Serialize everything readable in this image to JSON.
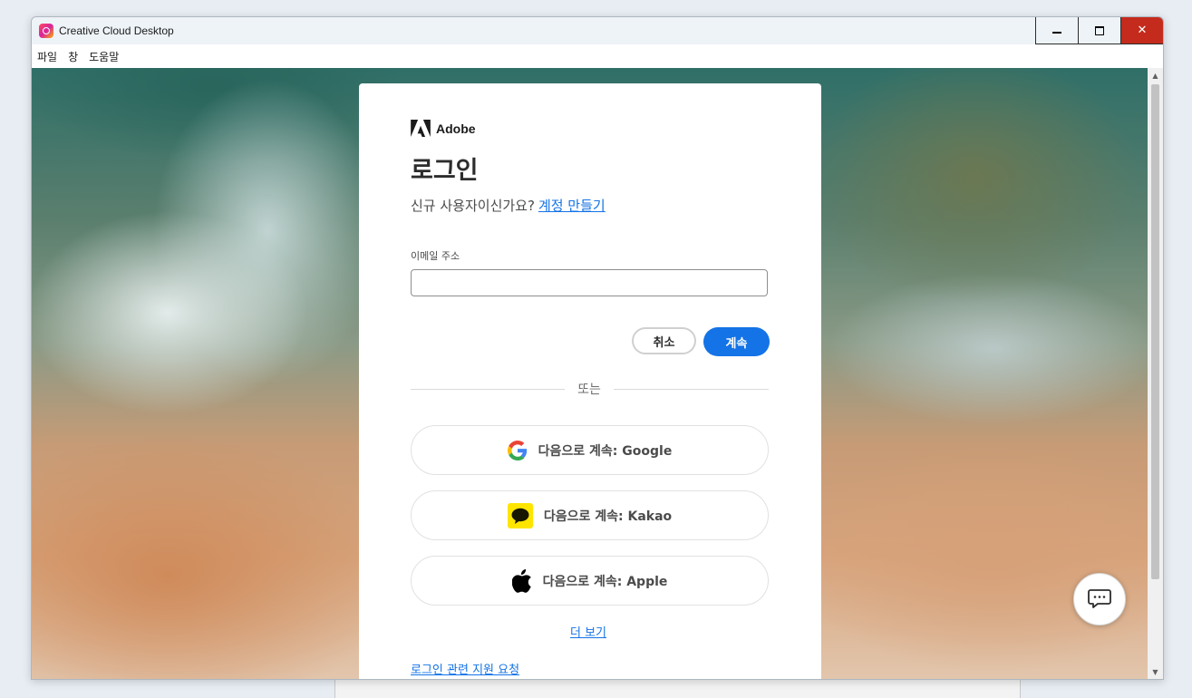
{
  "window": {
    "title": "Creative Cloud Desktop",
    "controls": {
      "minimize_icon": "minimize-icon",
      "maximize_icon": "maximize-icon",
      "close_icon": "close-icon",
      "close_glyph": "✕"
    }
  },
  "menu": {
    "items": [
      "파일",
      "창",
      "도움말"
    ]
  },
  "signin": {
    "brand": "Adobe",
    "heading": "로그인",
    "new_user_prompt": "신규 사용자이신가요?",
    "create_account_link": "계정 만들기",
    "email_label": "이메일 주소",
    "email_value": "",
    "cancel_label": "취소",
    "continue_label": "계속",
    "divider_text": "또는",
    "social": [
      {
        "label": "다음으로 계속: Google",
        "icon": "google-icon"
      },
      {
        "label": "다음으로 계속: Kakao",
        "icon": "kakao-icon"
      },
      {
        "label": "다음으로 계속: Apple",
        "icon": "apple-icon"
      }
    ],
    "more_link": "더 보기",
    "help_link": "로그인 관련 지원 요청"
  },
  "chat": {
    "icon": "chat-bubble-icon"
  },
  "colors": {
    "accent": "#1473e6",
    "close_button": "#c42b1c",
    "kakao_yellow": "#fee500"
  }
}
